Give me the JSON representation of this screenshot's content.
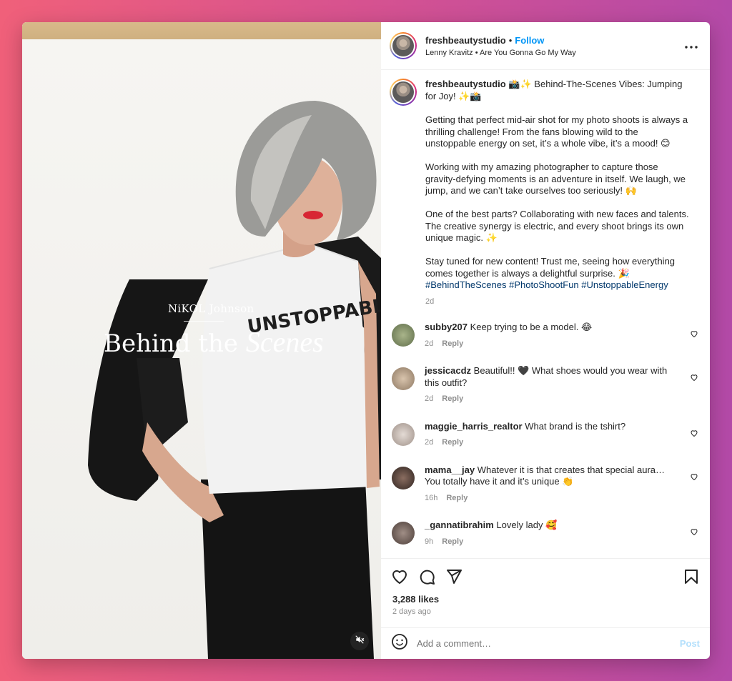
{
  "post": {
    "username": "freshbeautystudio",
    "follow_label": "Follow",
    "audio": "Lenny Kravitz • Are You Gonna Go My Way",
    "media_overlay": {
      "name": "NiKOL Johnson",
      "title_plain": "Behind the",
      "title_script": "Scenes",
      "shirt_text": "UNSTOPPABLE."
    }
  },
  "caption": {
    "username": "freshbeautystudio",
    "headline": "📸✨ Behind-The-Scenes Vibes: Jumping for Joy! ✨📸",
    "paragraphs": [
      "Getting that perfect mid-air shot for my photo shoots is always a thrilling challenge! From the fans blowing wild to the unstoppable energy on set, it’s a whole vibe, it’s a mood! 😊",
      "Working with my amazing photographer to capture those gravity-defying moments is an adventure in itself. We laugh, we jump, and we can’t take ourselves too seriously! 🙌",
      "One of the best parts? Collaborating with new faces and talents. The creative synergy is electric, and every shoot brings its own unique magic. ✨",
      "Stay tuned for new content! Trust me, seeing how everything comes together is always a delightful surprise. 🎉"
    ],
    "hashtags": "#BehindTheScenes #PhotoShootFun #UnstoppableEnergy",
    "time": "2d"
  },
  "comments": [
    {
      "user": "subby207",
      "text": "Keep trying to be a model. 😂",
      "time": "2d",
      "reply": "Reply",
      "avatar_color": "#7f8f6a"
    },
    {
      "user": "jessicacdz",
      "text": "Beautiful!! 🖤 What shoes would you wear with this outfit?",
      "time": "2d",
      "reply": "Reply",
      "avatar_color": "#b8a590"
    },
    {
      "user": "maggie_harris_realtor",
      "text": "What brand is the tshirt?",
      "time": "2d",
      "reply": "Reply",
      "avatar_color": "#cfc4be"
    },
    {
      "user": "mama__jay",
      "text": "Whatever it is that creates that special aura… You totally have it and it’s unique 👏",
      "time": "16h",
      "reply": "Reply",
      "avatar_color": "#4a3a33"
    },
    {
      "user": "_gannatibrahim",
      "text": "Lovely lady 🥰",
      "time": "9h",
      "reply": "Reply",
      "avatar_color": "#6b5b55"
    }
  ],
  "likes": "3,288 likes",
  "posted_ago": "2 days ago",
  "add_comment": {
    "placeholder": "Add a comment…",
    "post_label": "Post"
  },
  "icons": {
    "more": "more-options-icon",
    "like": "heart-icon",
    "comment": "comment-icon",
    "share": "share-icon",
    "save": "bookmark-icon",
    "emoji": "emoji-icon",
    "mute": "muted-speaker-icon"
  },
  "colors": {
    "link": "#0095f6",
    "hashtag": "#00376b",
    "post_disabled": "#b2dffc"
  }
}
